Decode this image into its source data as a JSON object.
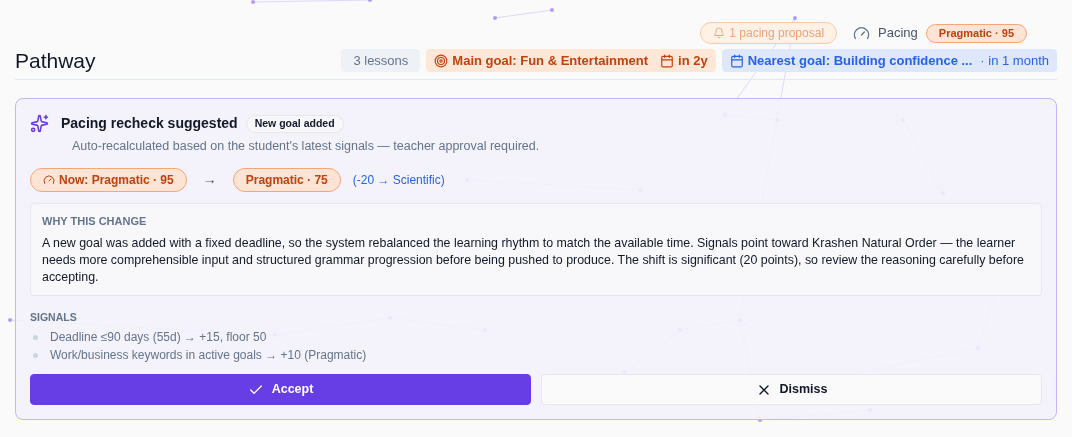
{
  "top_bar": {
    "proposal": "1 pacing proposal",
    "pacing_label": "Pacing",
    "pacing_badge": "Pragmatic · 95"
  },
  "header": {
    "title": "Pathway",
    "lessons": "3 lessons",
    "main_goal": {
      "label": "Main goal: Fun & Entertainment",
      "due": "in 2y"
    },
    "nearest_goal": {
      "label": "Nearest goal: Building confidence ...",
      "due": "· in 1 month"
    }
  },
  "card": {
    "title": "Pacing recheck suggested",
    "tag": "New goal added",
    "subtitle": "Auto-recalculated based on the student's latest signals — teacher approval required.",
    "current": "Now: Pragmatic · 95",
    "arrow": "→",
    "proposed": "Pragmatic · 75",
    "delta": "(-20 → Scientific)",
    "why_heading": "WHY THIS CHANGE",
    "why_text": "A new goal was added with a fixed deadline, so the system rebalanced the learning rhythm to match the available time. Signals point toward Krashen Natural Order — the learner needs more comprehensible input and structured grammar progression before being pushed to produce. The shift is significant (20 points), so review the reasoning carefully before accepting.",
    "signals_heading": "SIGNALS",
    "signals": [
      "Deadline ≤90 days (55d) → +15, floor 50",
      "Work/business keywords in active goals → +10 (Pragmatic)"
    ],
    "buttons": [
      {
        "label": "Accept",
        "kind": "primary"
      },
      {
        "label": "Dismiss",
        "kind": "secondary"
      }
    ]
  }
}
